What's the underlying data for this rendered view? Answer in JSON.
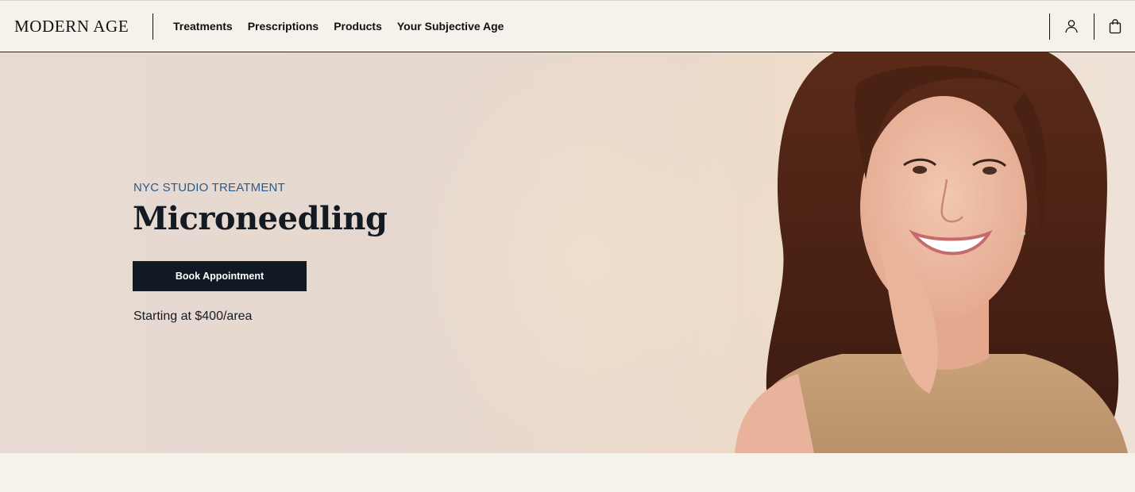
{
  "header": {
    "logo": "MODERN AGE",
    "nav": [
      "Treatments",
      "Prescriptions",
      "Products",
      "Your Subjective Age"
    ],
    "account_icon": "user-icon",
    "cart_icon": "shopping-bag-icon"
  },
  "hero": {
    "eyebrow": "NYC STUDIO TREATMENT",
    "title": "Microneedling",
    "cta_label": "Book Appointment",
    "price": "Starting at $400/area",
    "image": "smiling-woman-portrait"
  },
  "colors": {
    "header_bg": "#f5f2ec",
    "hero_bg": "#e6dad2",
    "eyebrow": "#2d5a86",
    "button_bg": "#111a24",
    "text": "#101820"
  }
}
